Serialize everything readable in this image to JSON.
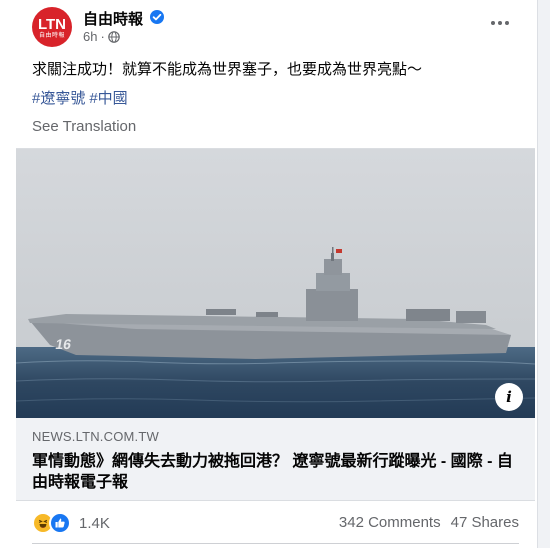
{
  "post": {
    "page_name": "自由時報",
    "avatar_text": "LTN",
    "avatar_subtext": "自由時報",
    "timestamp": "6h",
    "dot": "·",
    "text": "求關注成功！就算不能成為世界塞子，也要成為世界亮點～",
    "hashtags": [
      "#遼寧號",
      "#中國"
    ],
    "see_translation": "See Translation"
  },
  "link_preview": {
    "domain": "NEWS.LTN.COM.TW",
    "title": "軍情動態》網傳失去動力被拖回港？ 遼寧號最新行蹤曝光 - 國際 - 自由時報電子報",
    "info_icon": "info-icon"
  },
  "engagement": {
    "reaction_icons": [
      "haha-icon",
      "like-icon"
    ],
    "reaction_count": "1.4K",
    "comments": "342 Comments",
    "shares": "47 Shares"
  },
  "colors": {
    "brand_red": "#d8232a",
    "link_blue": "#385898",
    "verified_blue": "#1877f2",
    "secondary_text": "#65676b"
  }
}
